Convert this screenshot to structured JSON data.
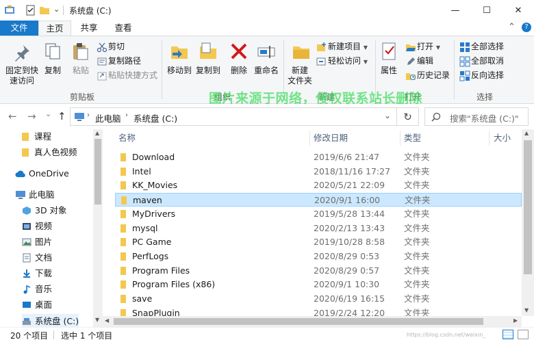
{
  "window": {
    "title": "系统盘 (C:)",
    "minimize": "—",
    "maximize": "☐",
    "close": "✕"
  },
  "quick_access": {
    "dropdown": "⌄",
    "icons": [
      "explorer-icon",
      "properties-icon",
      "new-folder-icon"
    ]
  },
  "ribbon_tabs": {
    "file": "文件",
    "home": "主页",
    "share": "共享",
    "view": "查看",
    "collapse": "⌃",
    "help": "?"
  },
  "ribbon": {
    "clipboard": {
      "pin": "固定到快\n速访问",
      "copy": "复制",
      "paste": "粘贴",
      "cut": "剪切",
      "copy_path": "复制路径",
      "paste_shortcut": "粘贴快捷方式",
      "label": "剪贴板"
    },
    "organize": {
      "move_to": "移动到",
      "copy_to": "复制到",
      "delete": "删除",
      "rename": "重命名",
      "label": "组织"
    },
    "new": {
      "new_folder": "新建\n文件夹",
      "new_item": "新建项目",
      "easy_access": "轻松访问",
      "label": "新建"
    },
    "open": {
      "properties": "属性",
      "open": "打开",
      "edit": "编辑",
      "history": "历史记录",
      "label": "打开"
    },
    "select": {
      "select_all": "全部选择",
      "select_none": "全部取消",
      "invert": "反向选择",
      "label": "选择"
    }
  },
  "navigation": {
    "back": "←",
    "forward": "→",
    "recent": "⌄",
    "up": "↑",
    "breadcrumb": [
      "此电脑",
      "系统盘 (C:)"
    ],
    "address_dropdown": "⌄",
    "refresh": "↻",
    "search_placeholder": "搜索\"系统盘 (C:)\""
  },
  "nav_pane": {
    "items": [
      {
        "label": "课程",
        "icon": "folder-icon"
      },
      {
        "label": "真人色视频",
        "icon": "folder-icon"
      },
      {
        "label": "OneDrive",
        "icon": "cloud-icon"
      },
      {
        "label": "此电脑",
        "icon": "computer-icon"
      },
      {
        "label": "3D 对象",
        "icon": "3d-objects-icon"
      },
      {
        "label": "视频",
        "icon": "video-icon"
      },
      {
        "label": "图片",
        "icon": "picture-icon"
      },
      {
        "label": "文档",
        "icon": "document-icon"
      },
      {
        "label": "下载",
        "icon": "download-icon"
      },
      {
        "label": "音乐",
        "icon": "music-icon"
      },
      {
        "label": "桌面",
        "icon": "desktop-icon"
      },
      {
        "label": "系统盘 (C:)",
        "icon": "drive-icon"
      }
    ]
  },
  "file_list": {
    "columns": {
      "name": "名称",
      "date": "修改日期",
      "type": "类型",
      "size": "大小"
    },
    "rows": [
      {
        "name": "Download",
        "date": "2019/6/6 21:47",
        "type": "文件夹"
      },
      {
        "name": "Intel",
        "date": "2018/11/16 17:27",
        "type": "文件夹"
      },
      {
        "name": "KK_Movies",
        "date": "2020/5/21 22:09",
        "type": "文件夹"
      },
      {
        "name": "maven",
        "date": "2020/9/1 16:00",
        "type": "文件夹",
        "selected": true
      },
      {
        "name": "MyDrivers",
        "date": "2019/5/28 13:44",
        "type": "文件夹"
      },
      {
        "name": "mysql",
        "date": "2020/2/13 13:43",
        "type": "文件夹"
      },
      {
        "name": "PC Game",
        "date": "2019/10/28 8:58",
        "type": "文件夹"
      },
      {
        "name": "PerfLogs",
        "date": "2020/8/29 0:53",
        "type": "文件夹"
      },
      {
        "name": "Program Files",
        "date": "2020/8/29 0:57",
        "type": "文件夹"
      },
      {
        "name": "Program Files (x86)",
        "date": "2020/9/1 10:30",
        "type": "文件夹"
      },
      {
        "name": "save",
        "date": "2020/6/19 16:15",
        "type": "文件夹"
      },
      {
        "name": "SnapPlugin",
        "date": "2019/2/24 12:20",
        "type": "文件夹"
      }
    ]
  },
  "status": {
    "count": "20 个项目",
    "selected": "选中 1 个项目",
    "footer_url": "https://blog.csdn.net/weixin_"
  },
  "watermark": "图片来源于网络，侵权联系站长删除",
  "colors": {
    "accent": "#1979ca",
    "selection": "#cce8ff",
    "folder": "#f3c84f"
  }
}
